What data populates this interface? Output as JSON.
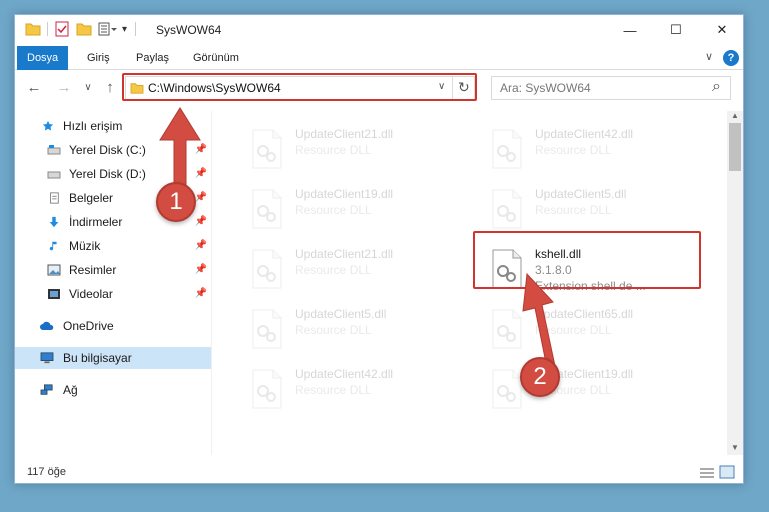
{
  "window": {
    "title": "SysWOW64",
    "minimize": "—",
    "maximize": "☐",
    "close": "✕"
  },
  "ribbon": {
    "tabs": [
      "Dosya",
      "Giriş",
      "Paylaş",
      "Görünüm"
    ],
    "expand": "∨",
    "help": "?"
  },
  "navbar": {
    "back": "←",
    "forward": "→",
    "recent": "∨",
    "up": "↑",
    "address": "C:\\Windows\\SysWOW64",
    "address_dropdown": "∨",
    "refresh": "↻",
    "search_placeholder": "Ara: SysWOW64",
    "search_icon": "⌕"
  },
  "sidebar": {
    "items": [
      {
        "label": "Hızlı erişim",
        "icon": "star-icon",
        "pinned": false
      },
      {
        "label": "Yerel Disk (C:)",
        "icon": "drive-icon",
        "pinned": true
      },
      {
        "label": "Yerel Disk (D:)",
        "icon": "drive-icon",
        "pinned": true
      },
      {
        "label": "Belgeler",
        "icon": "documents-icon",
        "pinned": true
      },
      {
        "label": "İndirmeler",
        "icon": "download-icon",
        "pinned": true
      },
      {
        "label": "Müzik",
        "icon": "music-icon",
        "pinned": true
      },
      {
        "label": "Resimler",
        "icon": "pictures-icon",
        "pinned": true
      },
      {
        "label": "Videolar",
        "icon": "video-icon",
        "pinned": true
      },
      {
        "label": "OneDrive",
        "icon": "cloud-icon",
        "pinned": false
      },
      {
        "label": "Bu bilgisayar",
        "icon": "computer-icon",
        "pinned": false
      },
      {
        "label": "Ağ",
        "icon": "network-icon",
        "pinned": false
      }
    ],
    "pin_glyph": "📌"
  },
  "files": [
    {
      "name": "UpdateClient21.dll",
      "line2": "Resource DLL",
      "line3": ""
    },
    {
      "name": "UpdateClient42.dll",
      "line2": "Resource DLL",
      "line3": ""
    },
    {
      "name": "UpdateClient19.dll",
      "line2": "Resource DLL",
      "line3": ""
    },
    {
      "name": "UpdateClient5.dll",
      "line2": "Resource DLL",
      "line3": ""
    },
    {
      "name": "UpdateClient21.dll",
      "line2": "Resource DLL",
      "line3": ""
    },
    {
      "name": "kshell.dll",
      "line2": "3.1.8.0",
      "line3": "Extension shell de ..."
    },
    {
      "name": "UpdateClient5.dll",
      "line2": "Resource DLL",
      "line3": ""
    },
    {
      "name": "UpdateClient65.dll",
      "line2": "Resource DLL",
      "line3": ""
    },
    {
      "name": "UpdateClient42.dll",
      "line2": "Resource DLL",
      "line3": ""
    },
    {
      "name": "UpdateClient19.dll",
      "line2": "Resource DLL",
      "line3": ""
    }
  ],
  "status": {
    "count": "117 öğe"
  },
  "annotations": {
    "badge1": "1",
    "badge2": "2",
    "accent": "#d0342c"
  },
  "colors": {
    "accent": "#1979ca",
    "selected": "#cce4f7"
  }
}
